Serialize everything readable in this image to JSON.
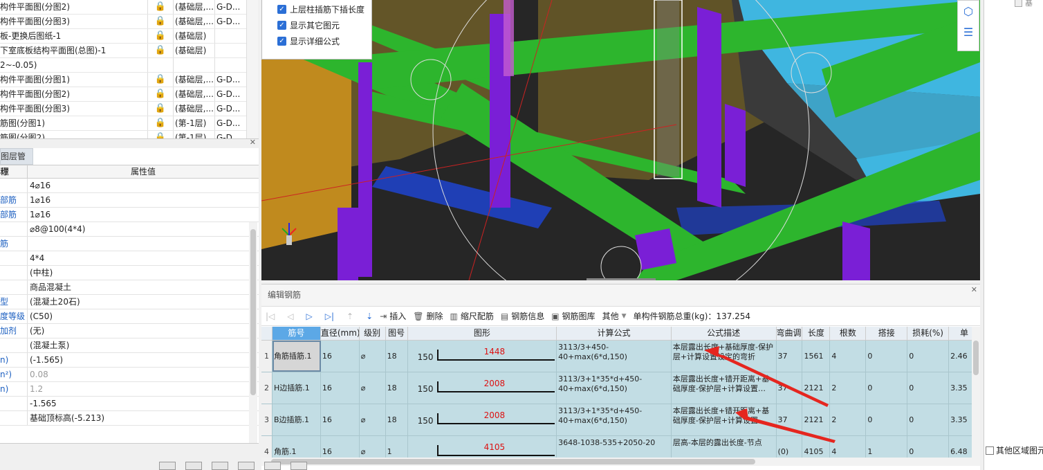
{
  "drawing_list": [
    {
      "name": "构件平面图(分图2)",
      "layer": "(基础层,...",
      "code": "G-D..."
    },
    {
      "name": "构件平面图(分图3)",
      "layer": "(基础层,...",
      "code": "G-D..."
    },
    {
      "name": "板-更换后图纸-1",
      "layer": "(基础层)",
      "code": ""
    },
    {
      "name": "下室底板结构平面图(总图)-1",
      "layer": "(基础层)",
      "code": ""
    },
    {
      "name": "2~-0.05)",
      "layer": "",
      "code": ""
    },
    {
      "name": "构件平面图(分图1)",
      "layer": "(基础层,...",
      "code": "G-D..."
    },
    {
      "name": "构件平面图(分图2)",
      "layer": "(基础层,...",
      "code": "G-D..."
    },
    {
      "name": "构件平面图(分图3)",
      "layer": "(基础层,...",
      "code": "G-D..."
    },
    {
      "name": "筋图(分图1)",
      "layer": "(第-1层)",
      "code": "G-D..."
    },
    {
      "name": "筋图(分图2)",
      "layer": "(第-1层)",
      "code": "G-D..."
    }
  ],
  "properties_panel": {
    "tab_label": "图层管理",
    "col_name": "称",
    "col_value": "属性值",
    "rows": [
      {
        "name": "",
        "value": "4⌀16"
      },
      {
        "name": "部筋",
        "value": "1⌀16"
      },
      {
        "name": "部筋",
        "value": "1⌀16"
      },
      {
        "name": "",
        "value": "⌀8@100(4*4)"
      },
      {
        "name": "筋",
        "value": ""
      },
      {
        "name": "",
        "value": "4*4"
      },
      {
        "name": "",
        "value": "(中柱)"
      },
      {
        "name": "",
        "value": "商品混凝土"
      },
      {
        "name": "型",
        "value": "(混凝土20石)"
      },
      {
        "name": "度等级",
        "value": "(C50)"
      },
      {
        "name": "加剂",
        "value": "(无)"
      },
      {
        "name": "",
        "value": "(混凝土泵)"
      },
      {
        "name": "n)",
        "value": "(-1.565)"
      },
      {
        "name": "n²)",
        "value": "0.08"
      },
      {
        "name": "n)",
        "value": "1.2"
      },
      {
        "name": "",
        "value": "-1.565"
      },
      {
        "name": "",
        "value": "基础顶标高(-5.213)"
      }
    ]
  },
  "view_options": [
    {
      "label": "上层柱插筋下插长度",
      "checked": true
    },
    {
      "label": "显示其它图元",
      "checked": true
    },
    {
      "label": "显示详细公式",
      "checked": true
    }
  ],
  "right_panel": {
    "top_label": "基",
    "other_region_label": "其他区域图元"
  },
  "editor": {
    "title": "编辑钢筋",
    "toolbar": {
      "insert": "插入",
      "delete": "删除",
      "scale_rebar": "缩尺配筋",
      "rebar_info": "钢筋信息",
      "rebar_library": "钢筋图库",
      "other": "其他",
      "total_weight": "单构件钢筋总重(kg)：137.254"
    },
    "columns": [
      "筋号",
      "直径(mm)",
      "级别",
      "图号",
      "图形",
      "计算公式",
      "公式描述",
      "弯曲调整",
      "长度",
      "根数",
      "搭接",
      "损耗(%)",
      "单"
    ],
    "rows": [
      {
        "no": "1",
        "name": "角筋插筋.1",
        "dia": "16",
        "grade": "⌀",
        "fig": "18",
        "shape_left": "150",
        "shape_val": "1448",
        "formula": "3113/3+450-40+max(6*d,150)",
        "desc": "本层露出长度+基础厚度-保护层+计算设置设定的弯折",
        "bend": "37",
        "len": "1561",
        "count": "4",
        "lap": "0",
        "loss": "0",
        "unit": "2.46"
      },
      {
        "no": "2",
        "name": "H边插筋.1",
        "dia": "16",
        "grade": "⌀",
        "fig": "18",
        "shape_left": "150",
        "shape_val": "2008",
        "formula": "3113/3+1*35*d+450-40+max(6*d,150)",
        "desc": "本层露出长度+错开距离+基础厚度-保护层+计算设置…",
        "bend": "37",
        "len": "2121",
        "count": "2",
        "lap": "0",
        "loss": "0",
        "unit": "3.35"
      },
      {
        "no": "3",
        "name": "B边插筋.1",
        "dia": "16",
        "grade": "⌀",
        "fig": "18",
        "shape_left": "150",
        "shape_val": "2008",
        "formula": "3113/3+1*35*d+450-40+max(6*d,150)",
        "desc": "本层露出长度+错开距离+基础厚度-保护层+计算设置…",
        "bend": "37",
        "len": "2121",
        "count": "2",
        "lap": "0",
        "loss": "0",
        "unit": "3.35"
      },
      {
        "no": "4",
        "name": "角筋.1",
        "dia": "16",
        "grade": "⌀",
        "fig": "1",
        "shape_left": "",
        "shape_val": "4105",
        "formula": "3648-1038-535+2050-20",
        "desc": "层高-本层的露出长度-节点",
        "bend": "(0)",
        "len": "4105",
        "count": "4",
        "lap": "1",
        "loss": "0",
        "unit": "6.48"
      }
    ]
  },
  "colors": {
    "beam_green": "#2db52d",
    "column_purple": "#7a1fd6",
    "slab_cyan": "#3fb6e0",
    "row_teal": "#c2dde4",
    "accent_blue": "#2b6fd6",
    "annotation_red": "#e5261f"
  }
}
